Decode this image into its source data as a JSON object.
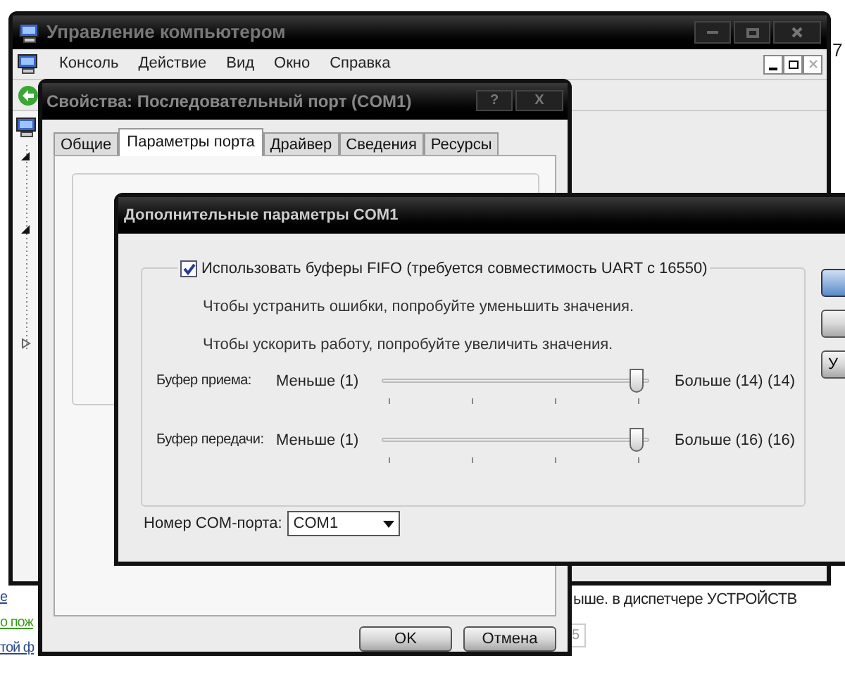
{
  "background_page": {
    "top_right_text": "7",
    "links": [
      {
        "text": "е",
        "kind": "link"
      },
      {
        "text": "о пож",
        "kind": "visited"
      },
      {
        "text": "той ф",
        "kind": "link"
      }
    ],
    "body_text": "ыше. в диспетчере УСТРОЙСТВ",
    "page_number": "5"
  },
  "main_window": {
    "title": "Управление компьютером",
    "menu": [
      "Консоль",
      "Действие",
      "Вид",
      "Окно",
      "Справка"
    ]
  },
  "properties_window": {
    "title": "Свойства: Последовательный порт (COM1)",
    "help": "?",
    "close": "X",
    "tabs": [
      {
        "label": "Общие",
        "selected": false
      },
      {
        "label": "Параметры порта",
        "selected": true
      },
      {
        "label": "Драйвер",
        "selected": false
      },
      {
        "label": "Сведения",
        "selected": false
      },
      {
        "label": "Ресурсы",
        "selected": false
      }
    ],
    "buttons": [
      "OK",
      "Отмена"
    ]
  },
  "advanced_dialog": {
    "title": "Дополнительные параметры COM1",
    "fifo": {
      "label": "Использовать буферы FIFO (требуется совместимость UART с 16550)",
      "checked": true
    },
    "hints": [
      "Чтобы устранить ошибки, попробуйте уменьшить значения.",
      "Чтобы ускорить работу, попробуйте увеличить значения."
    ],
    "sliders": [
      {
        "name": "Буфер приема:",
        "min_label": "Меньше (1)",
        "max_label": "Больше (14)",
        "reading": "(14)",
        "level": 1
      },
      {
        "name": "Буфер передачи:",
        "min_label": "Меньше (1)",
        "max_label": "Больше (16)",
        "reading": "(16)",
        "level": 1
      }
    ],
    "com_port": {
      "label": "Номер COM-порта:",
      "value": "COM1"
    },
    "side_buttons": [
      {
        "kind": "default"
      },
      {
        "kind": "plain"
      },
      {
        "kind": "text",
        "text": "У"
      }
    ]
  }
}
